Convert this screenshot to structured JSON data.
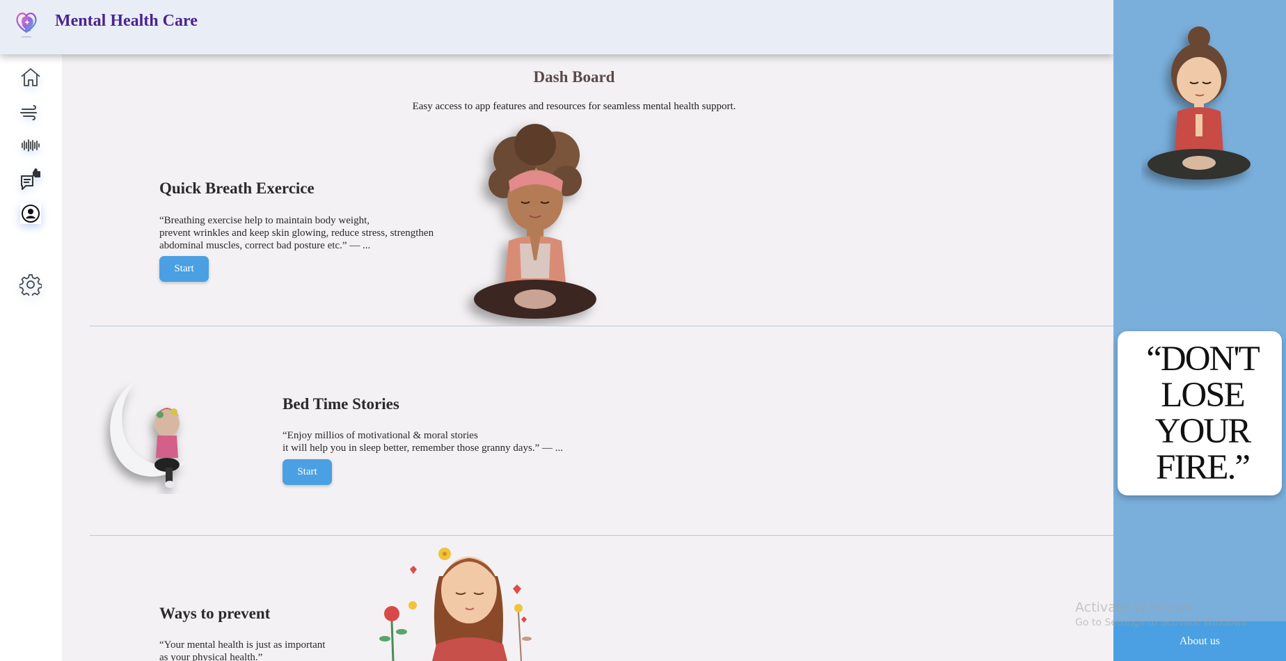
{
  "header": {
    "app_title": "Mental Health Care",
    "logo_icon": "heart-head-logo-icon"
  },
  "sidebar": {
    "items": [
      {
        "name": "home",
        "icon": "home-icon"
      },
      {
        "name": "breathing",
        "icon": "wind-icon"
      },
      {
        "name": "audio",
        "icon": "sound-wave-icon"
      },
      {
        "name": "feedback",
        "icon": "thumbs-up-chat-icon"
      },
      {
        "name": "profile",
        "icon": "user-circle-icon",
        "active": true
      },
      {
        "name": "settings",
        "icon": "gear-icon"
      }
    ]
  },
  "dashboard": {
    "title": "Dash Board",
    "subtitle": "Easy access to app features and resources for seamless mental health support."
  },
  "sections": [
    {
      "title": "Quick Breath Exercice",
      "text_lines": [
        "“Breathing exercise help to maintain body weight,",
        "prevent wrinkles and keep skin glowing, reduce stress, strengthen",
        "abdominal muscles, correct bad posture etc.” — ..."
      ],
      "button": "Start",
      "illustration": "meditating-girl-illustration"
    },
    {
      "title": "Bed Time Stories",
      "text_lines": [
        "“Enjoy millios of motivational & moral stories",
        "it will help you in sleep better, remember those granny days.” — ..."
      ],
      "button": "Start",
      "illustration": "moon-doll-illustration"
    },
    {
      "title": "Ways to prevent",
      "text_lines": [
        "“Your mental health is just as important",
        "as your physical health.”"
      ],
      "illustration": "woman-flowers-illustration"
    }
  ],
  "right_panel": {
    "illustration": "meditating-girl-bun-illustration",
    "quote_lines": [
      "“DON'T",
      "LOSE",
      "YOUR",
      "FIRE.”"
    ],
    "about_button": "About us"
  },
  "watermark": {
    "title": "Activate Windows",
    "subtitle": "Go to Settings to activate Windows."
  },
  "colors": {
    "accent": "#4aa0e2",
    "panel": "#7aafdc",
    "title": "#4b2390",
    "background": "#f3f1f3"
  }
}
